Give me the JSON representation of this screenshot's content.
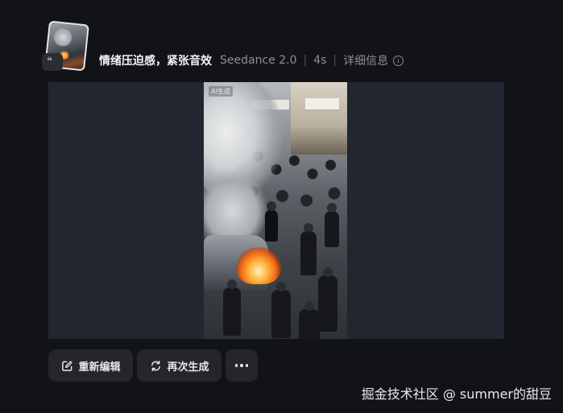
{
  "header": {
    "prompt_text": "情绪压迫感，紧张音效",
    "model": "Seedance 2.0",
    "duration": "4s",
    "detail_link": "详细信息"
  },
  "icons": {
    "reference_quote": "quote-icon",
    "info": "info-icon",
    "edit": "edit-icon",
    "regenerate": "refresh-icon",
    "more": "more-horizontal-icon"
  },
  "media": {
    "ai_label": "AI生成",
    "panel_color": "#222631"
  },
  "actions": {
    "edit_label": "重新编辑",
    "regenerate_label": "再次生成"
  },
  "watermark": "掘金技术社区 @ summer的甜豆",
  "colors": {
    "background": "#121316",
    "button_bg": "#24262c",
    "muted_text": "#8c8f97"
  }
}
